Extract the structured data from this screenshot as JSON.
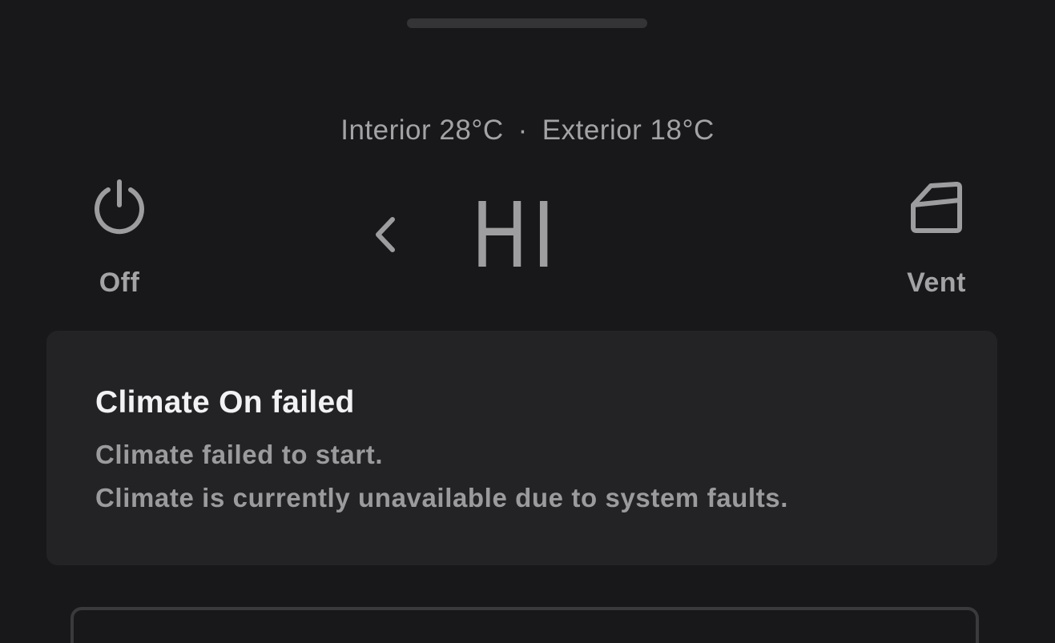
{
  "temperatures": {
    "interior": "Interior 28°C",
    "separator": "·",
    "exterior": "Exterior 18°C"
  },
  "controls": {
    "power": {
      "label": "Off",
      "icon": "power-icon"
    },
    "vent": {
      "label": "Vent",
      "icon": "car-window-icon"
    },
    "decrease": {
      "icon": "chevron-left-icon"
    },
    "setpoint": "HI"
  },
  "alert": {
    "title": "Climate On failed",
    "line1": "Climate failed to start.",
    "line2": "Climate is currently unavailable due to system faults."
  },
  "colors": {
    "background": "#18181a",
    "card": "#232325",
    "text_primary": "#f2f2f4",
    "text_secondary": "#a3a3a5"
  }
}
